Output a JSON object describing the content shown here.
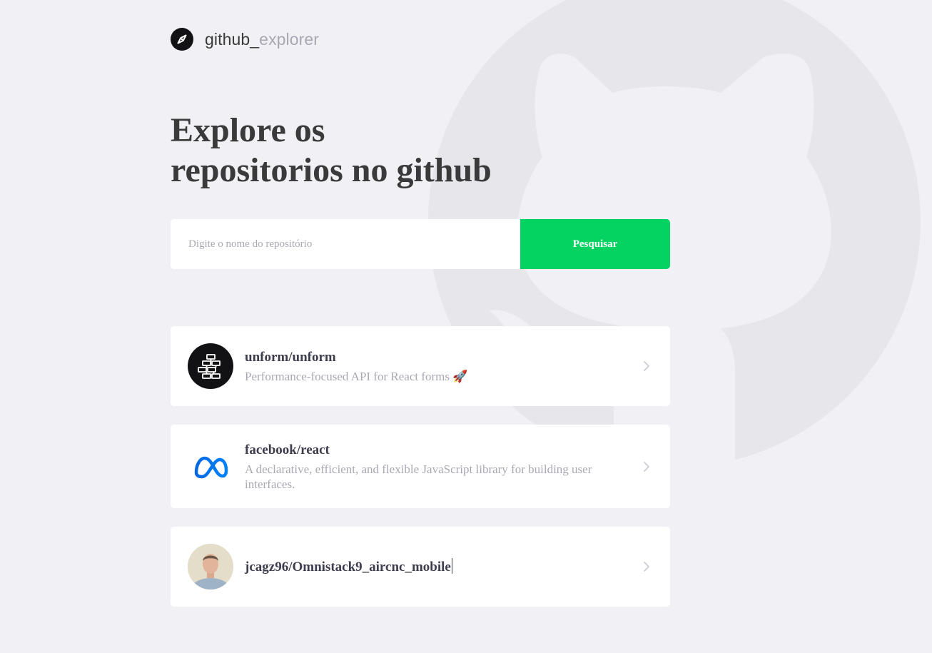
{
  "header": {
    "logo_icon": "compass-icon",
    "brand_prefix": "github_",
    "brand_suffix": "explorer"
  },
  "hero": {
    "title_line1": "Explore os",
    "title_line2": "repositorios no github"
  },
  "search": {
    "placeholder": "Digite o nome do repositório",
    "value": "",
    "button_label": "Pesquisar"
  },
  "repositories": [
    {
      "full_name": "unform/unform",
      "description": "Performance-focused API for React forms 🚀",
      "avatar_icon": "unform-logo-icon"
    },
    {
      "full_name": "facebook/react",
      "description": "A declarative, efficient, and flexible JavaScript library for building user interfaces.",
      "avatar_icon": "meta-logo-icon"
    },
    {
      "full_name": "jcagz96/Omnistack9_aircnc_mobile",
      "description": "",
      "avatar_icon": "user-avatar"
    }
  ],
  "colors": {
    "background": "#F0F0F5",
    "accent": "#04D361",
    "title": "#3A3A3A",
    "muted": "#A8A8B3",
    "card": "#FFFFFF"
  }
}
